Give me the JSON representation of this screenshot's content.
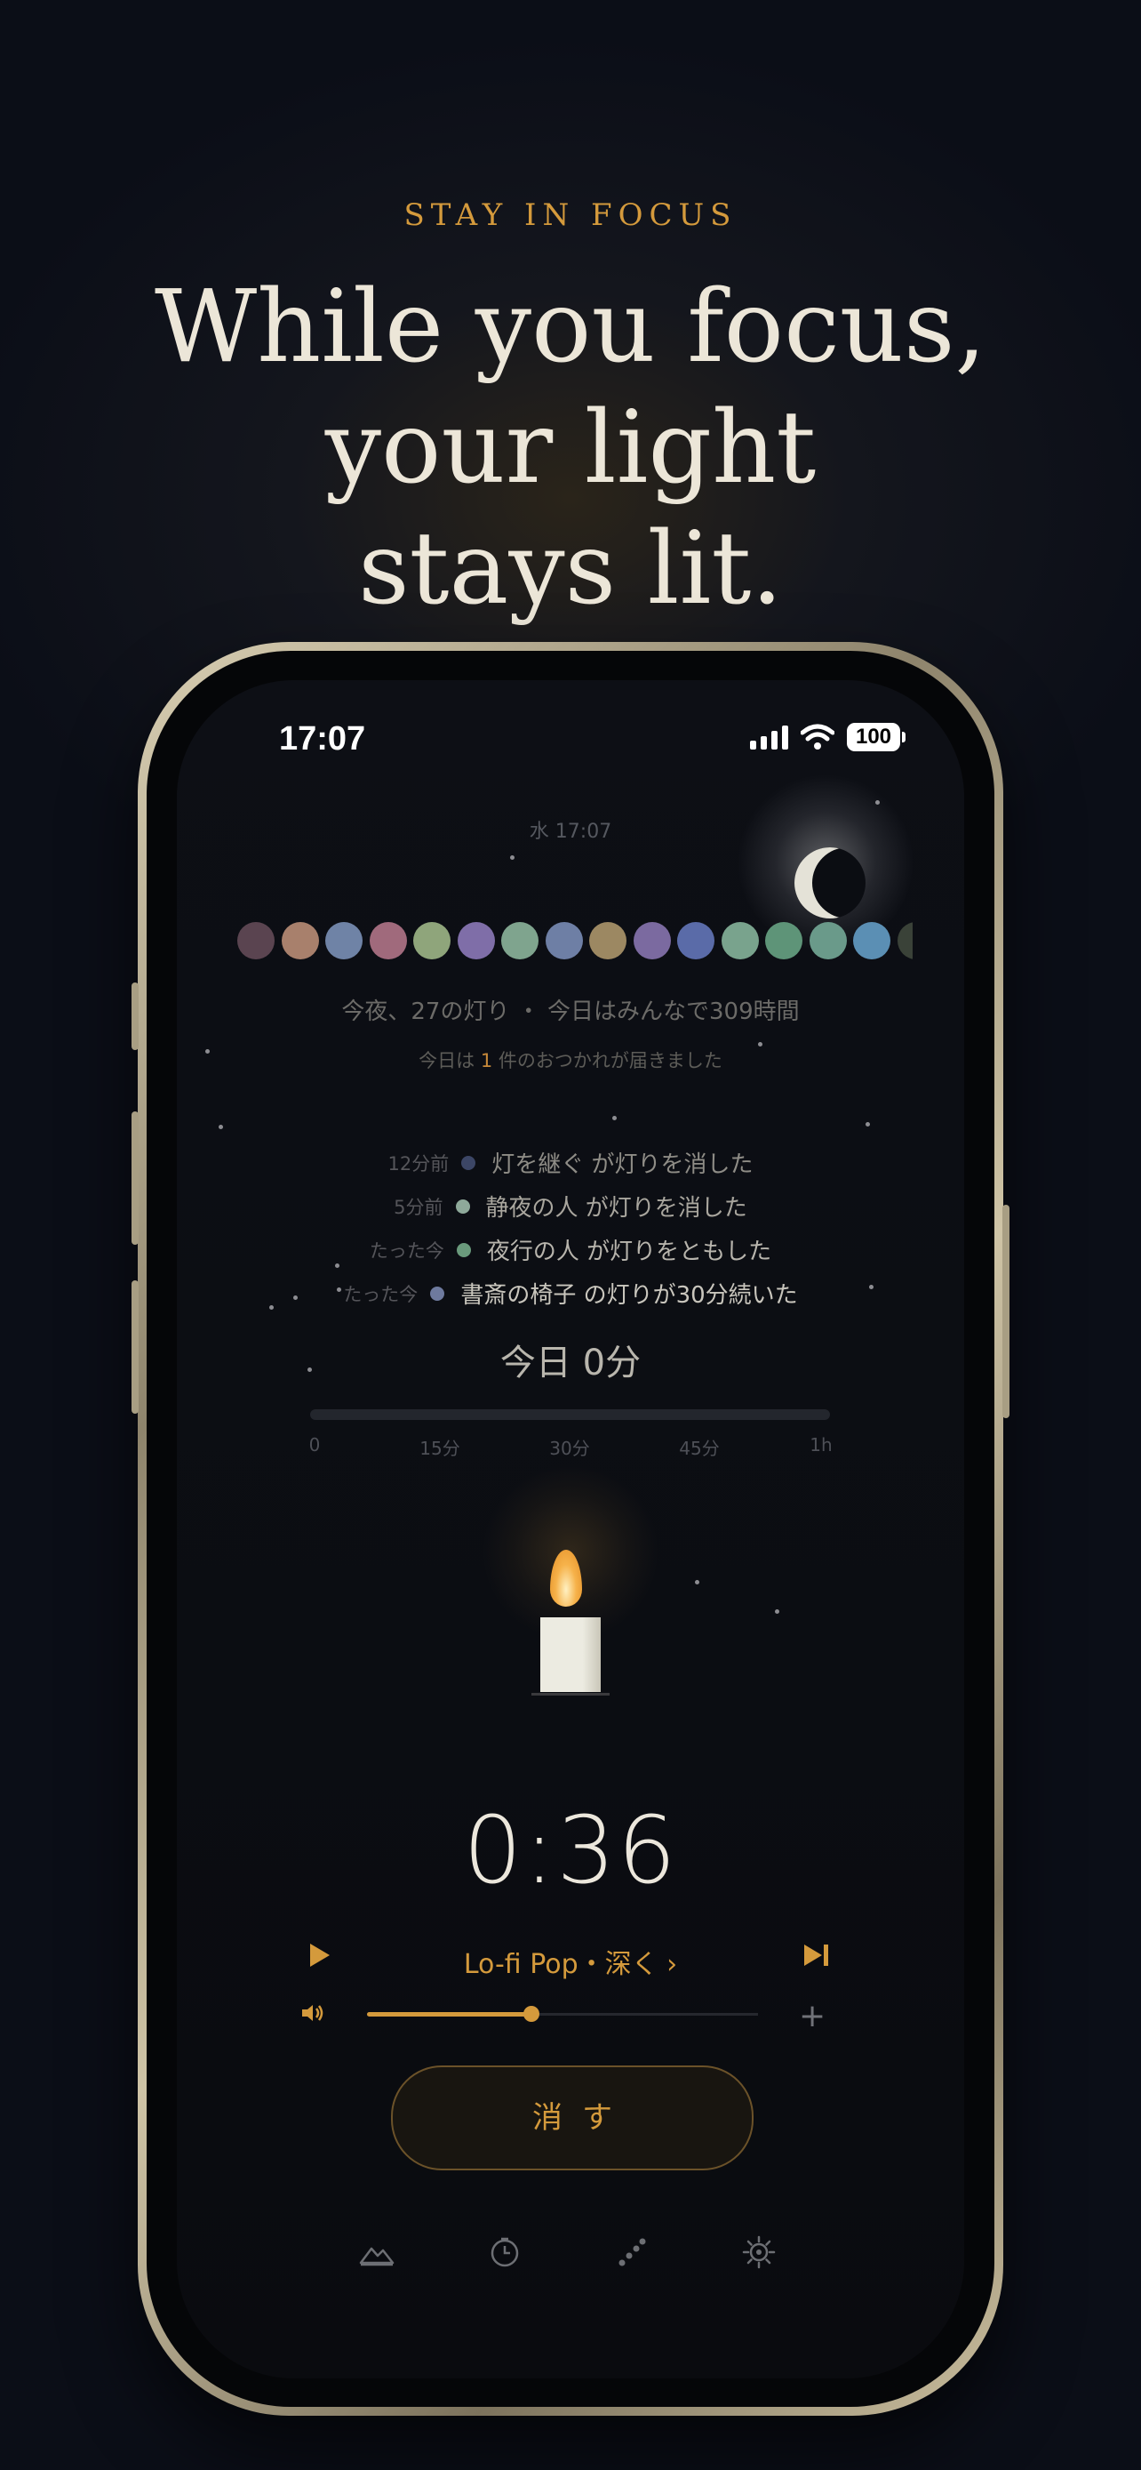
{
  "marketing": {
    "eyebrow": "STAY IN FOCUS",
    "headline_lines": [
      "While you focus,",
      "your light",
      "stays lit."
    ]
  },
  "status_bar": {
    "time": "17:07",
    "battery": "100"
  },
  "app": {
    "date_time": "水 17:07",
    "lights_summary": "今夜、27の灯り ・ 今日はみんなで309時間",
    "notice_prefix": "今日は",
    "notice_count": "1",
    "notice_suffix": "件のおつかれが届きました",
    "light_dot_colors": [
      "#5a4450",
      "#a8806c",
      "#6f83a6",
      "#a06a7c",
      "#8fa57b",
      "#7f6ea8",
      "#7fa48e",
      "#6e7fa5",
      "#9c8862",
      "#7b6aa0",
      "#5a6ba8",
      "#79a38d",
      "#5e9478",
      "#6a9a8a",
      "#5b8fb4",
      "#3a4238"
    ],
    "feed": [
      {
        "time": "12分前",
        "dot": "#3c4666",
        "text": "灯を継ぐ が灯りを消した"
      },
      {
        "time": "5分前",
        "dot": "#8ea99a",
        "text": "静夜の人 が灯りを消した"
      },
      {
        "time": "たった今",
        "dot": "#6a9a7c",
        "text": "夜行の人 が灯りをともした"
      },
      {
        "time": "たった今",
        "dot": "#6e7a9e",
        "text": "書斎の椅子 の灯りが30分続いた"
      }
    ],
    "today_total": "今日  0分",
    "today_progress": 0,
    "progress_ticks": [
      "0",
      "15分",
      "30分",
      "45分",
      "1h"
    ],
    "timer": "0:36",
    "track": "Lo-fi Pop・深く ›",
    "volume": 0.42,
    "extinguish_label": "消す",
    "colors": {
      "accent": "#d49a3c",
      "background": "#0b0d12"
    },
    "tabs": [
      {
        "name": "tab-landscape",
        "icon": "mountain-icon"
      },
      {
        "name": "tab-timer",
        "icon": "clock-icon"
      },
      {
        "name": "tab-constellation",
        "icon": "stars-icon"
      },
      {
        "name": "tab-settings",
        "icon": "gear-icon"
      }
    ]
  }
}
